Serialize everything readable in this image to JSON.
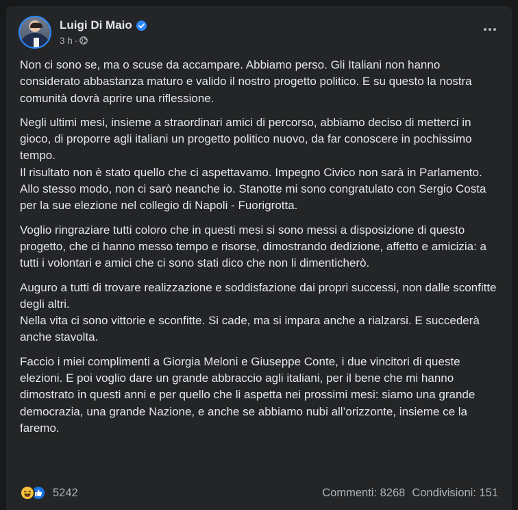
{
  "post": {
    "author": "Luigi Di Maio",
    "verified": true,
    "time": "3 h",
    "audience_icon": "globe-icon",
    "menu_icon": "more-options-icon",
    "paragraphs": [
      "Non ci sono se, ma o scuse da accampare. Abbiamo perso. Gli Italiani non hanno considerato abbastanza maturo e valido il nostro progetto politico. E su questo la nostra comunità dovrà aprire una riflessione.",
      "Negli ultimi mesi, insieme a straordinari amici di percorso, abbiamo deciso di metterci in gioco, di proporre agli italiani un progetto politico nuovo, da far conoscere in pochissimo tempo.\nIl risultato non è stato quello che ci aspettavamo. Impegno Civico non sarà in Parlamento. Allo stesso modo, non ci sarò neanche io. Stanotte mi sono congratulato con Sergio Costa per la sue elezione nel collegio di Napoli - Fuorigrotta.",
      "Voglio ringraziare tutti coloro che in questi mesi si sono messi a disposizione di questo progetto, che ci hanno messo tempo e risorse, dimostrando dedizione, affetto e amicizia: a tutti i volontari e amici che ci sono stati dico che non li dimenticherò.",
      "Auguro a tutti di trovare realizzazione e soddisfazione dai propri successi, non dalle sconfitte degli altri.\nNella vita ci sono vittorie e sconfitte. Si cade, ma si impara anche a rialzarsi. E succederà anche stavolta.",
      "Faccio i miei complimenti a Giorgia Meloni e Giuseppe Conte, i due vincitori di queste elezioni. E poi voglio dare un grande abbraccio agli italiani, per il bene che mi hanno dimostrato in questi anni e per quello che li aspetta nei prossimi mesi: siamo una grande democrazia, una grande Nazione, e anche se abbiamo nubi all’orizzonte, insieme ce la faremo."
    ]
  },
  "footer": {
    "reaction_icons": [
      "haha-reaction-icon",
      "like-reaction-icon"
    ],
    "reactions_count": "5242",
    "comments": "Commenti: 8268",
    "shares": "Condivisioni: 151"
  },
  "colors": {
    "background": "#18191a",
    "card": "#242526",
    "text_primary": "#e4e6eb",
    "text_secondary": "#b0b3b8",
    "verified_blue": "#2d88ff",
    "like_blue": "#1b74e4",
    "haha_yellow": "#f7c13e"
  }
}
